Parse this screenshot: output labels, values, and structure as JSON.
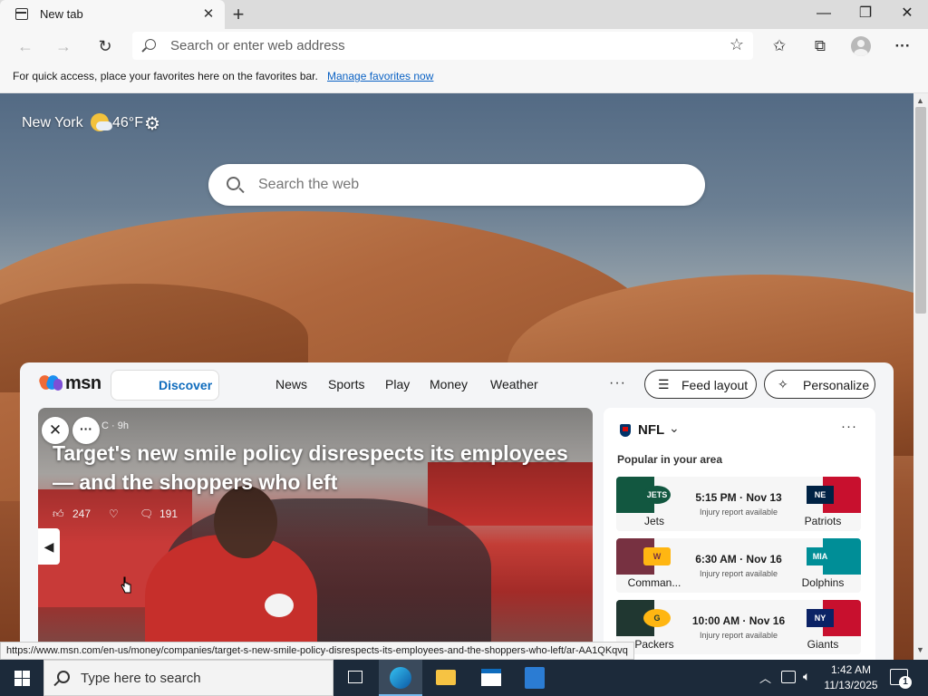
{
  "browser": {
    "tab_title": "New tab",
    "tab_close": "✕",
    "new_tab": "+",
    "window_controls": {
      "minimize": "—",
      "restore": "❐",
      "close": "✕"
    },
    "address_placeholder": "Search or enter web address",
    "favorites_message": "For quick access, place your favorites here on the favorites bar.",
    "favorites_link": "Manage favorites now",
    "status_url": "https://www.msn.com/en-us/money/companies/target-s-new-smile-policy-disrespects-its-employees-and-the-shoppers-who-left/ar-AA1QKqvq"
  },
  "newtab": {
    "weather": {
      "city": "New York",
      "temperature": "46°F",
      "icon": "partly-cloudy-icon"
    },
    "search_placeholder": "Search the web"
  },
  "msn": {
    "logo_text": "msn",
    "tabs": [
      {
        "label": "Discover"
      },
      {
        "label": "News"
      },
      {
        "label": "Sports"
      },
      {
        "label": "Play"
      },
      {
        "label": "Money"
      },
      {
        "label": "Weather"
      }
    ],
    "more": "···",
    "feed_layout": "Feed layout",
    "personalize": "Personalize"
  },
  "hero": {
    "source": "C · 9h",
    "headline": "Target's new smile policy disrespects its employees — and the shoppers who left",
    "likes": "247",
    "comments": "191"
  },
  "nfl": {
    "title": "NFL",
    "subtitle": "Popular in your area",
    "games": [
      {
        "home": "Jets",
        "away": "Patriots",
        "time": "5:15 PM · Nov 13",
        "note": "Injury report available",
        "home_color": "#125740",
        "away_color": "#c8102e"
      },
      {
        "home": "Comman...",
        "away": "Dolphins",
        "time": "6:30 AM · Nov 16",
        "note": "Injury report available",
        "home_color": "#773141",
        "away_color": "#008e97"
      },
      {
        "home": "Packers",
        "away": "Giants",
        "time": "10:00 AM · Nov 16",
        "note": "Injury report available",
        "home_color": "#203731",
        "away_color": "#0b2265"
      }
    ]
  },
  "taskbar": {
    "search_placeholder": "Type here to search",
    "time": "1:42 AM",
    "date": "11/13/2025",
    "notifications": "1"
  }
}
